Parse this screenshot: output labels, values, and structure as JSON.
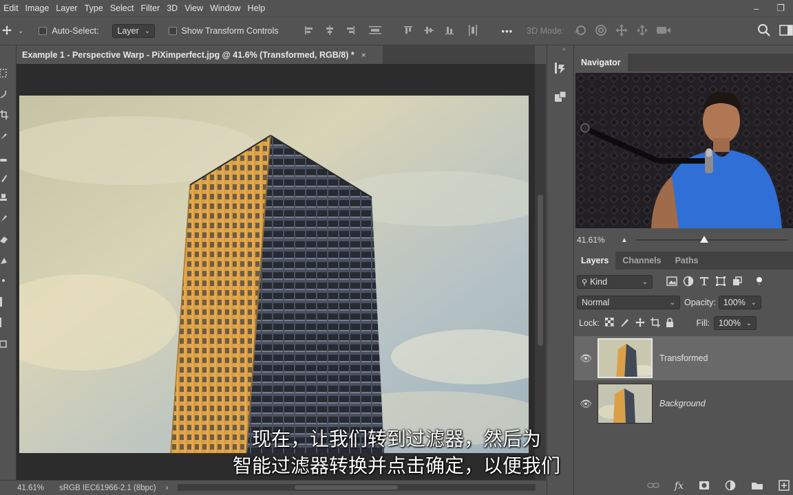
{
  "menu": [
    "Edit",
    "Image",
    "Layer",
    "Type",
    "Select",
    "Filter",
    "3D",
    "View",
    "Window",
    "Help"
  ],
  "window_controls": {
    "minimize": "–",
    "restore": "❐"
  },
  "options_bar": {
    "auto_select_label": "Auto-Select:",
    "auto_select_target": "Layer",
    "transform_controls_label": "Show Transform Controls",
    "more": "•••",
    "mode_3d_label": "3D Mode:"
  },
  "document": {
    "tab_title": "Example 1 - Perspective Warp - PiXimperfect.jpg @ 41.6% (Transformed, RGB/8) *",
    "close": "×"
  },
  "status": {
    "zoom": "41.61%",
    "profile": "sRGB IEC61966-2.1 (8bpc)",
    "arrow": "›",
    "left_arrow": "‹"
  },
  "navigator": {
    "title": "Navigator",
    "zoom": "41.61%",
    "zoom_level": 0.45
  },
  "layers_panel": {
    "tabs": [
      "Layers",
      "Channels",
      "Paths"
    ],
    "filter_kind": "Kind",
    "blend_mode": "Normal",
    "opacity_label": "Opacity:",
    "opacity_value": "100%",
    "lock_label": "Lock:",
    "fill_label": "Fill:",
    "fill_value": "100%",
    "layers": [
      {
        "name": "Transformed",
        "visible": true,
        "selected": true,
        "italic": false
      },
      {
        "name": "Background",
        "visible": true,
        "selected": false,
        "italic": true
      }
    ]
  },
  "subtitles": {
    "line1": "现在，让我们转到过滤器，然后为",
    "line2": "智能过滤器转换并点击确定，以便我们"
  },
  "colors": {
    "ui_panel": "#535353",
    "ui_dark": "#424242",
    "canvas_bg": "#2c2c2c",
    "building": "#e0a646",
    "sky": "#aebcc4",
    "shirt": "#2f6fd6"
  }
}
